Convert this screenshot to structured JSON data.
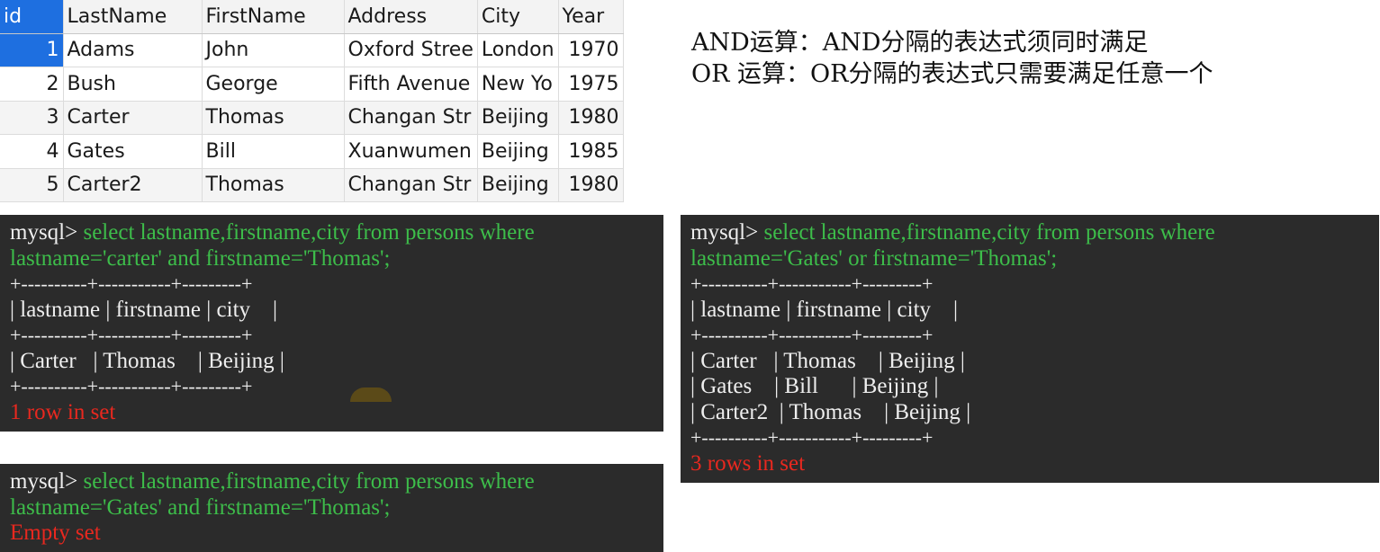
{
  "table": {
    "columns": [
      "id",
      "LastName",
      "FirstName",
      "Address",
      "City",
      "Year"
    ],
    "rows": [
      {
        "id": "1",
        "LastName": "Adams",
        "FirstName": "John",
        "Address": "Oxford Stree",
        "City": "London",
        "Year": "1970"
      },
      {
        "id": "2",
        "LastName": "Bush",
        "FirstName": "George",
        "Address": "Fifth Avenue",
        "City": "New Yo",
        "Year": "1975"
      },
      {
        "id": "3",
        "LastName": "Carter",
        "FirstName": "Thomas",
        "Address": "Changan Str",
        "City": "Beijing",
        "Year": "1980"
      },
      {
        "id": "4",
        "LastName": "Gates",
        "FirstName": "Bill",
        "Address": "Xuanwumen",
        "City": "Beijing",
        "Year": "1985"
      },
      {
        "id": "5",
        "LastName": "Carter2",
        "FirstName": "Thomas",
        "Address": "Changan Str",
        "City": "Beijing",
        "Year": "1980"
      }
    ]
  },
  "notes": {
    "and_line": "AND运算：AND分隔的表达式须同时满足",
    "or_line": "OR 运算：OR分隔的表达式只需要满足任意一个"
  },
  "term_and": {
    "prompt": "mysql> ",
    "cmd1": "select lastname,firstname,city from persons where",
    "cmd2": "lastname='carter' and firstname='Thomas';",
    "sep": "+----------+-----------+---------+",
    "header": "| lastname | firstname | city    |",
    "rows": [
      "| Carter   | Thomas    | Beijing |"
    ],
    "result": "1 row in set"
  },
  "term_or": {
    "prompt": "mysql> ",
    "cmd1": "select lastname,firstname,city from persons where",
    "cmd2": "lastname='Gates' or firstname='Thomas';",
    "sep": "+----------+-----------+---------+",
    "header": "| lastname | firstname | city    |",
    "rows": [
      "| Carter   | Thomas    | Beijing |",
      "| Gates    | Bill      | Beijing |",
      "| Carter2  | Thomas    | Beijing |"
    ],
    "result": "3 rows in set"
  },
  "term_empty": {
    "prompt": "mysql> ",
    "cmd1": "select lastname,firstname,city from persons where",
    "cmd2": "lastname='Gates' and firstname='Thomas';",
    "result": "Empty set"
  },
  "colors": {
    "selection": "#1e6fe0",
    "terminal_bg": "#2b2b2b",
    "command_green": "#3dbd4a",
    "result_red": "#e8281f"
  }
}
